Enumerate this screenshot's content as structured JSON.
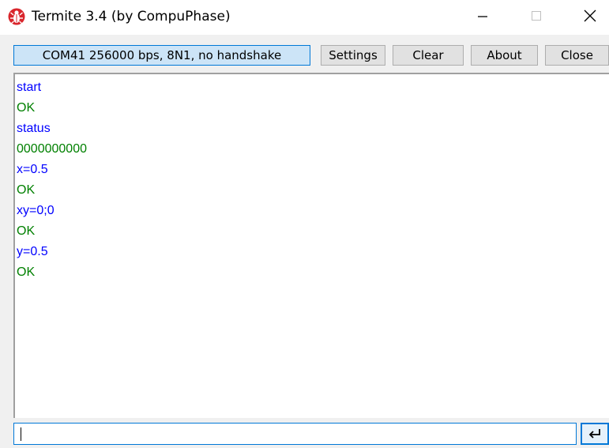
{
  "window": {
    "title": "Termite 3.4 (by CompuPhase)",
    "app_icon": "termite-bug-icon",
    "controls": [
      "minimize-icon",
      "maximize-icon",
      "close-icon"
    ]
  },
  "toolbar": {
    "status": "COM41 256000 bps, 8N1, no handshake",
    "buttons": {
      "settings": "Settings",
      "clear": "Clear",
      "about": "About",
      "close": "Close"
    }
  },
  "terminal": {
    "colors": {
      "sent": "#0000ff",
      "received": "#008000"
    },
    "lines": [
      {
        "text": "start",
        "kind": "sent"
      },
      {
        "text": "OK",
        "kind": "received"
      },
      {
        "text": "status",
        "kind": "sent"
      },
      {
        "text": "0000000000",
        "kind": "received"
      },
      {
        "text": "x=0.5",
        "kind": "sent"
      },
      {
        "text": "OK",
        "kind": "received"
      },
      {
        "text": "xy=0;0",
        "kind": "sent"
      },
      {
        "text": "OK",
        "kind": "received"
      },
      {
        "text": "y=0.5",
        "kind": "sent"
      },
      {
        "text": "OK",
        "kind": "received"
      }
    ]
  },
  "input": {
    "value": "",
    "send_icon": "enter-return-icon"
  }
}
